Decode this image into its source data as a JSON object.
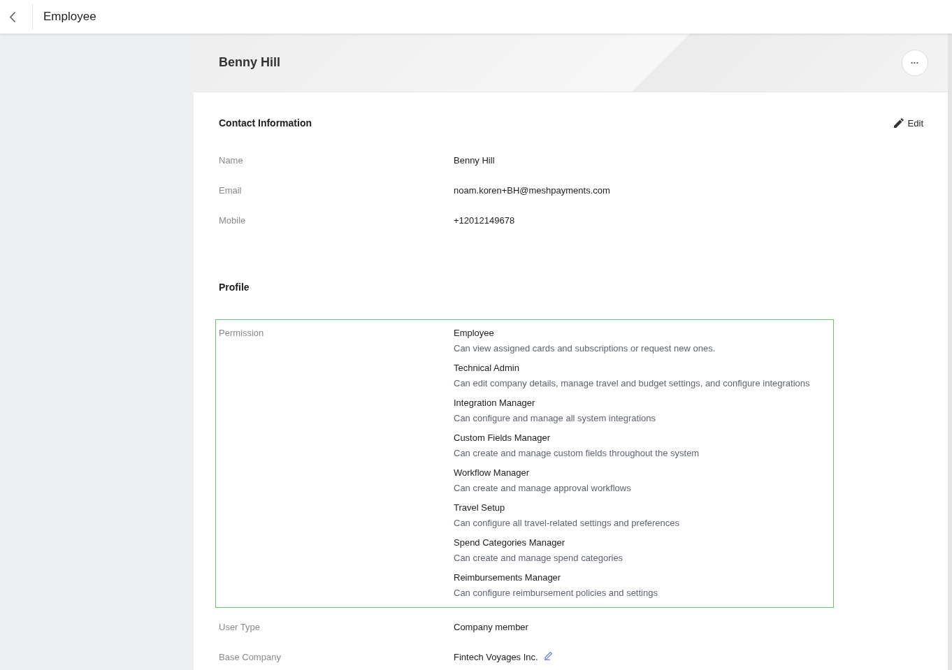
{
  "top_bar": {
    "title": "Employee"
  },
  "header": {
    "name": "Benny Hill",
    "more_button": "•••"
  },
  "contact_information": {
    "title": "Contact Information",
    "edit_button": "Edit",
    "fields": [
      {
        "label": "Name",
        "value": "Benny Hill"
      },
      {
        "label": "Email",
        "value": "noam.koren+BH@meshpayments.com"
      },
      {
        "label": "Mobile",
        "value": "+12012149678"
      }
    ]
  },
  "profile": {
    "title": "Profile",
    "permission": {
      "label": "Permission",
      "roles": [
        {
          "name": "Employee",
          "description": "Can view assigned cards and subscriptions or request new ones."
        },
        {
          "name": "Technical Admin",
          "description": "Can edit company details, manage travel and budget settings, and configure integrations"
        },
        {
          "name": "Integration Manager",
          "description": "Can configure and manage all system integrations"
        },
        {
          "name": "Custom Fields Manager",
          "description": "Can create and manage custom fields throughout the system"
        },
        {
          "name": "Workflow Manager",
          "description": "Can create and manage approval workflows"
        },
        {
          "name": "Travel Setup",
          "description": "Can configure all travel-related settings and preferences"
        },
        {
          "name": "Spend Categories Manager",
          "description": "Can create and manage spend categories"
        },
        {
          "name": "Reimbursements Manager",
          "description": "Can configure reimbursement policies and settings"
        }
      ]
    },
    "fields": [
      {
        "label": "User Type",
        "value": "Company member",
        "editable": false
      },
      {
        "label": "Base Company",
        "value": "Fintech Voyages Inc.",
        "editable": true
      }
    ]
  }
}
